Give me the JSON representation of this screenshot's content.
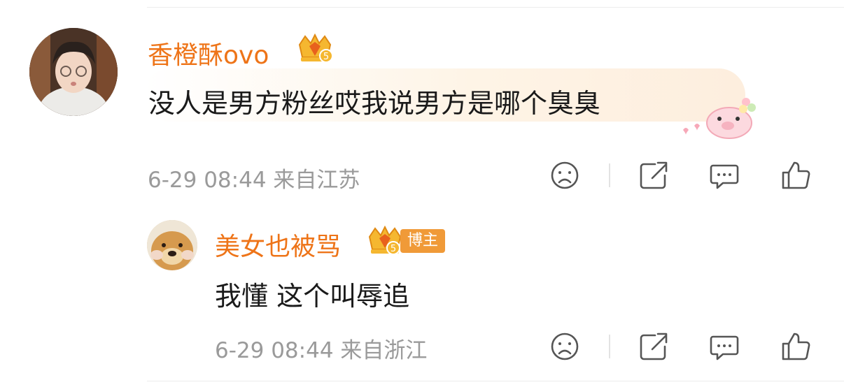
{
  "comments": [
    {
      "username": "香橙酥ovo",
      "badge_level": "5",
      "text": "没人是男方粉丝哎我说男方是哪个臭臭",
      "meta": "6-29 08:44 来自江苏",
      "avatar_icon": "user-avatar-photo",
      "sticker_icon": "pig-sticker-icon"
    },
    {
      "username": "美女也被骂",
      "badge_level": "5",
      "tag": "博主",
      "text": "我懂 这个叫辱追",
      "meta": "6-29 08:44 来自浙江",
      "avatar_icon": "dog-avatar-photo"
    }
  ],
  "actions": [
    "dislike-icon",
    "share-icon",
    "comment-icon",
    "like-icon"
  ],
  "colors": {
    "username": "#ee7418",
    "meta": "#9a9a9a",
    "badge_gold": "#f5b730",
    "tag_bg": "#f09a38"
  }
}
